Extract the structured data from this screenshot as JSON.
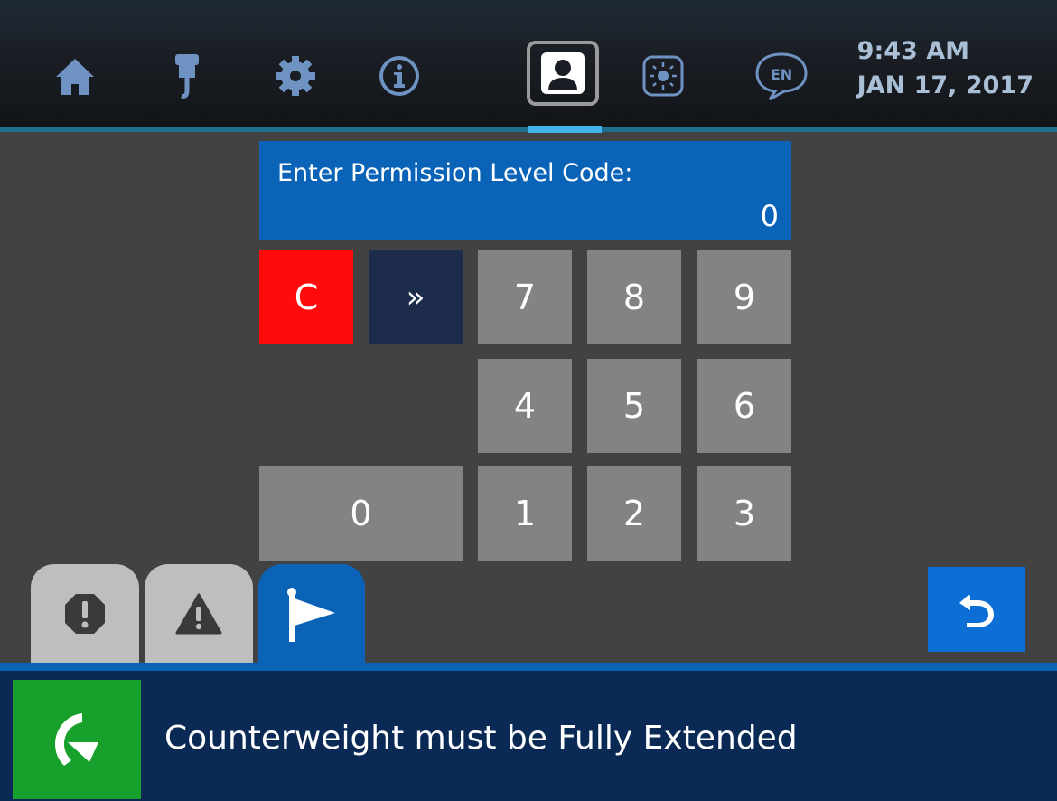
{
  "header": {
    "icons": [
      "home-icon",
      "crane-hook-icon",
      "gear-icon",
      "info-icon",
      "user-profile-icon",
      "brightness-icon",
      "language-icon"
    ],
    "language_code": "EN",
    "time": "9:43 AM",
    "date": "JAN 17, 2017",
    "active_tab": "user-profile-icon"
  },
  "code_entry": {
    "label": "Enter Permission Level Code:",
    "value": "0"
  },
  "keypad": {
    "clear": "C",
    "next": "»",
    "k7": "7",
    "k8": "8",
    "k9": "9",
    "k4": "4",
    "k5": "5",
    "k6": "6",
    "k0": "0",
    "k1": "1",
    "k2": "2",
    "k3": "3"
  },
  "tabs": [
    {
      "icon": "stop-alert-icon",
      "active": false
    },
    {
      "icon": "warning-icon",
      "active": false
    },
    {
      "icon": "flag-icon",
      "active": true
    }
  ],
  "status": {
    "icon": "rotate-arrow-icon",
    "message": "Counterweight must be Fully Extended"
  },
  "colors": {
    "accent_blue": "#0b63b8",
    "clear_red": "#ff0b0b",
    "status_green": "#17a12c",
    "status_bg": "#0a2a55"
  }
}
